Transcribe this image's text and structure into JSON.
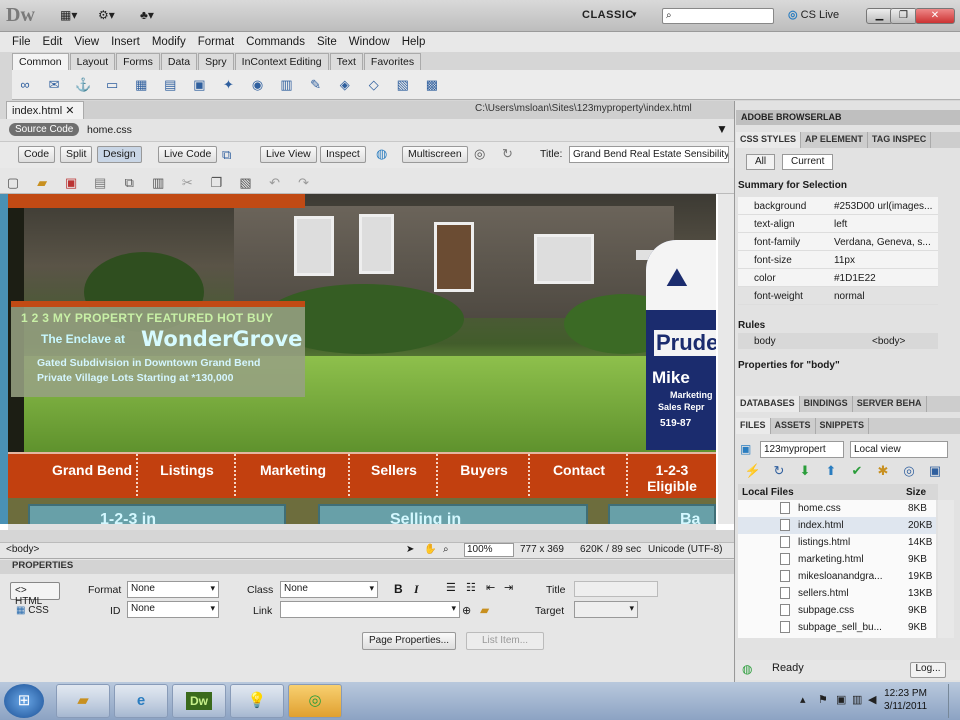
{
  "app": {
    "logo": "Dw",
    "workspace": "CLASSIC",
    "search_placeholder": "",
    "cslive": "CS Live"
  },
  "menu": [
    "File",
    "Edit",
    "View",
    "Insert",
    "Modify",
    "Format",
    "Commands",
    "Site",
    "Window",
    "Help"
  ],
  "insert_tabs": [
    "Common",
    "Layout",
    "Forms",
    "Data",
    "Spry",
    "InContext Editing",
    "Text",
    "Favorites"
  ],
  "doc": {
    "tab": "index.html",
    "path": "C:\\Users\\msloan\\Sites\\123myproperty\\index.html",
    "source_code": "Source Code",
    "related": "home.css"
  },
  "doc_toolbar": {
    "code": "Code",
    "split": "Split",
    "design": "Design",
    "live_code": "Live Code",
    "live_view": "Live View",
    "inspect": "Inspect",
    "multiscreen": "Multiscreen",
    "title_label": "Title:",
    "title_value": "Grand Bend Real Estate Sensibility:"
  },
  "page": {
    "promo_line1": "1 2 3 MY PROPERTY FEATURED HOT BUY",
    "promo_line2": "The Enclave at",
    "promo_brand": "WonderGrove",
    "promo_line3": "Gated Subdivision in Downtown Grand Bend",
    "promo_line4": "Private Village Lots Starting at *130,000",
    "sign_brand": "Prude",
    "sign_agent": "Mike",
    "sign_sub1": "Marketing",
    "sign_sub2": "Sales Repr",
    "sign_phone": "519-87",
    "nav": [
      "Grand Bend",
      "Listings",
      "Marketing",
      "Sellers",
      "Buyers",
      "Contact",
      "1-2-3 Eligible"
    ],
    "thumbs": [
      "1-2-3 in",
      "Selling in",
      "Ba"
    ]
  },
  "status": {
    "tag": "<body>",
    "zoom": "100%",
    "size": "777 x 369",
    "download": "620K / 89 sec",
    "encoding": "Unicode (UTF-8)"
  },
  "properties": {
    "header": "PROPERTIES",
    "html_btn": "HTML",
    "css_btn": "CSS",
    "format_label": "Format",
    "format_value": "None",
    "class_label": "Class",
    "class_value": "None",
    "id_label": "ID",
    "id_value": "None",
    "link_label": "Link",
    "link_value": "",
    "title_label": "Title",
    "target_label": "Target",
    "page_props": "Page Properties...",
    "list_item": "List Item..."
  },
  "right": {
    "browserlab": "ADOBE BROWSERLAB",
    "css_tabs": [
      "CSS STYLES",
      "AP ELEMENT",
      "TAG INSPEC"
    ],
    "all": "All",
    "current": "Current",
    "summary": "Summary for Selection",
    "css_props": [
      {
        "k": "background",
        "v": "#253D00 url(images..."
      },
      {
        "k": "text-align",
        "v": "left"
      },
      {
        "k": "font-family",
        "v": "Verdana, Geneva, s..."
      },
      {
        "k": "font-size",
        "v": "11px"
      },
      {
        "k": "color",
        "v": "#1D1E22"
      },
      {
        "k": "font-weight",
        "v": "normal"
      }
    ],
    "rules": "Rules",
    "rule_name": "body",
    "rule_tag": "<body>",
    "props_for": "Properties for \"body\"",
    "db_tabs": [
      "DATABASES",
      "BINDINGS",
      "SERVER BEHA"
    ],
    "file_tabs": [
      "FILES",
      "ASSETS",
      "SNIPPETS"
    ],
    "site": "123mypropert",
    "view": "Local view",
    "files_hdr": "Local Files",
    "size_hdr": "Size",
    "files": [
      {
        "n": "home.css",
        "s": "8KB"
      },
      {
        "n": "index.html",
        "s": "20KB"
      },
      {
        "n": "listings.html",
        "s": "14KB"
      },
      {
        "n": "marketing.html",
        "s": "9KB"
      },
      {
        "n": "mikesloanandgra...",
        "s": "19KB"
      },
      {
        "n": "sellers.html",
        "s": "13KB"
      },
      {
        "n": "subpage.css",
        "s": "9KB"
      },
      {
        "n": "subpage_sell_bu...",
        "s": "9KB"
      }
    ],
    "ready": "Ready",
    "log": "Log..."
  },
  "taskbar": {
    "time": "12:23 PM",
    "date": "3/11/2011"
  }
}
